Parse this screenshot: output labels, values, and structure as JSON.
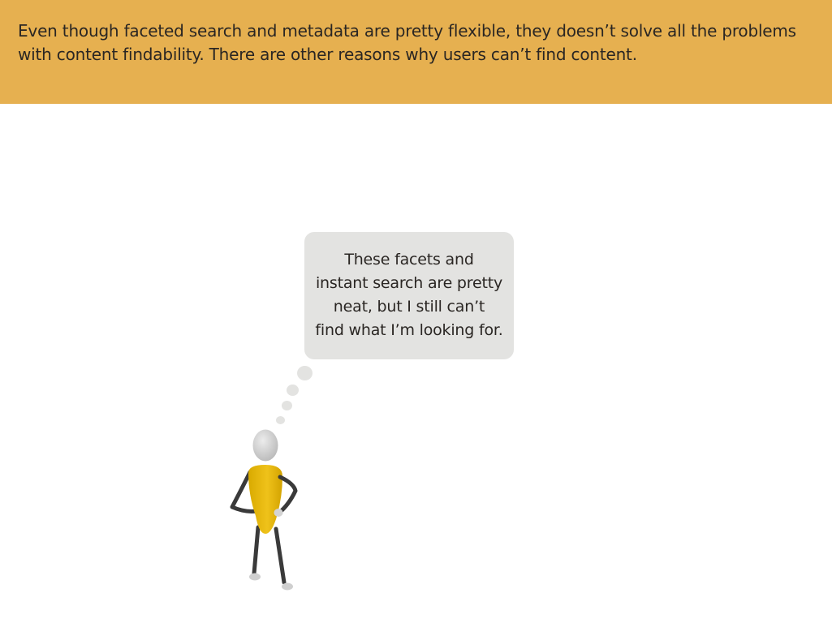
{
  "header": {
    "text": "Even though faceted search and metadata are pretty flexible, they doesn’t solve all the problems with content findability. There are other reasons why users can’t find content.",
    "background_color": "#E6B050"
  },
  "thought_bubble": {
    "text": "These facets and\ninstant search are pretty\nneat, but I still can’t\nfind what I’m looking for.",
    "background_color": "#E3E3E1"
  },
  "figure": {
    "icon": "thinking-person-icon",
    "body_color": "#E0B400",
    "head_color": "#D2D2D2",
    "limb_color": "#3A3A3A"
  }
}
